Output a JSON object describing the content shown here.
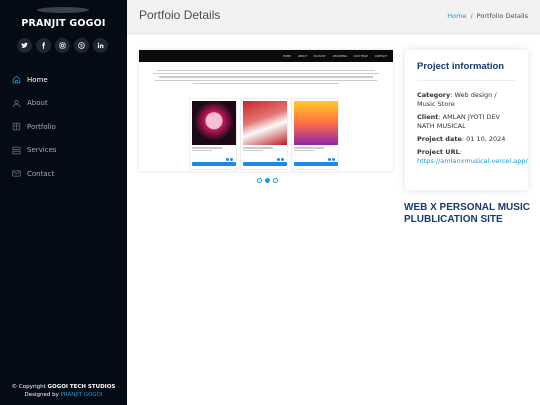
{
  "sidebar": {
    "brand": "PRANJIT GOGOI",
    "socials": [
      {
        "icon": "twitter-icon",
        "glyph": "t"
      },
      {
        "icon": "facebook-icon",
        "glyph": "f"
      },
      {
        "icon": "instagram-icon",
        "glyph": "◎"
      },
      {
        "icon": "skype-icon",
        "glyph": "S"
      },
      {
        "icon": "linkedin-icon",
        "glyph": "in"
      }
    ],
    "nav": [
      {
        "label": "Home",
        "icon": "home-icon",
        "active": true
      },
      {
        "label": "About",
        "icon": "person-icon",
        "active": false
      },
      {
        "label": "Portfolio",
        "icon": "book-icon",
        "active": false
      },
      {
        "label": "Services",
        "icon": "server-icon",
        "active": false
      },
      {
        "label": "Contact",
        "icon": "envelope-icon",
        "active": false
      }
    ],
    "footer": {
      "copyright_prefix": "© Copyright ",
      "copyright_name": "GOGOI TECH STUDIOS",
      "designed_prefix": "Designed by ",
      "designed_name": "PRANJIT GOGOI"
    }
  },
  "header": {
    "title": "Portfoio Details",
    "breadcrumb_home": "Home",
    "breadcrumb_sep": "/",
    "breadcrumb_current": "Portfolio Details"
  },
  "screenshot": {
    "nav_items": [
      "HOME",
      "ABOUT",
      "PLAYLIST",
      "UPCOMING",
      "OUR TEAM",
      "CONTACT"
    ],
    "slides": 3,
    "active_slide": 2
  },
  "info": {
    "title": "Project information",
    "category_label": "Category",
    "category_value": ": Web design / Music Store",
    "client_label": "Client",
    "client_value": ": AMLAN JYOTI DEV NATH MUSICAL",
    "date_label": "Project date",
    "date_value": ": 01 10, 2024",
    "url_label": "Project URL",
    "url_value": "https://amlanxmusical.vercel.app/"
  },
  "description": {
    "title": "WEB X PERSONAL MUSIC PLUBLICATION SITE"
  },
  "colors": {
    "accent": "#149ddd",
    "sidebar_bg": "#040b14",
    "heading": "#173b6c"
  }
}
